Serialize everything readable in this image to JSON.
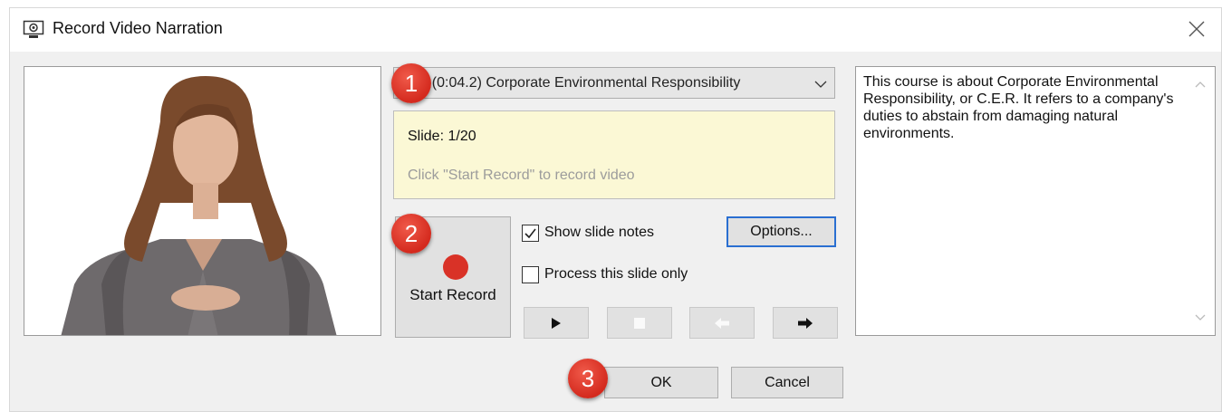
{
  "window": {
    "title": "Record Video Narration",
    "title_icon": "webcam-icon",
    "close_icon": "close-icon"
  },
  "slide_select": {
    "value": "1. (0:04.2) Corporate Environmental Responsibility",
    "icon": "chevron-down-icon"
  },
  "info": {
    "slide_label": "Slide: 1/20",
    "hint": "Click \"Start Record\" to record video"
  },
  "record": {
    "label": "Start Record",
    "icon": "record-dot-icon",
    "color": "#d93227"
  },
  "options": {
    "show_notes_label": "Show slide notes",
    "show_notes_checked": true,
    "process_only_label": "Process this slide only",
    "process_only_checked": false,
    "options_button": "Options..."
  },
  "playback": [
    {
      "name": "play-button",
      "icon": "play-icon",
      "enabled": true
    },
    {
      "name": "stop-button",
      "icon": "stop-icon",
      "enabled": false
    },
    {
      "name": "back-button",
      "icon": "arrow-left-icon",
      "enabled": false
    },
    {
      "name": "next-button",
      "icon": "arrow-right-icon",
      "enabled": true
    }
  ],
  "notes": {
    "text": "This course is about Corporate Environmental Responsibility, or C.E.R. It refers to a company's duties to abstain from damaging natural environments."
  },
  "footer": {
    "ok": "OK",
    "cancel": "Cancel"
  },
  "annotations": {
    "badge1": "1",
    "badge2": "2",
    "badge3": "3",
    "color": "#d42a1e"
  },
  "colors": {
    "accent": "#2a6fd1",
    "info_bg": "#fbf8d5"
  }
}
